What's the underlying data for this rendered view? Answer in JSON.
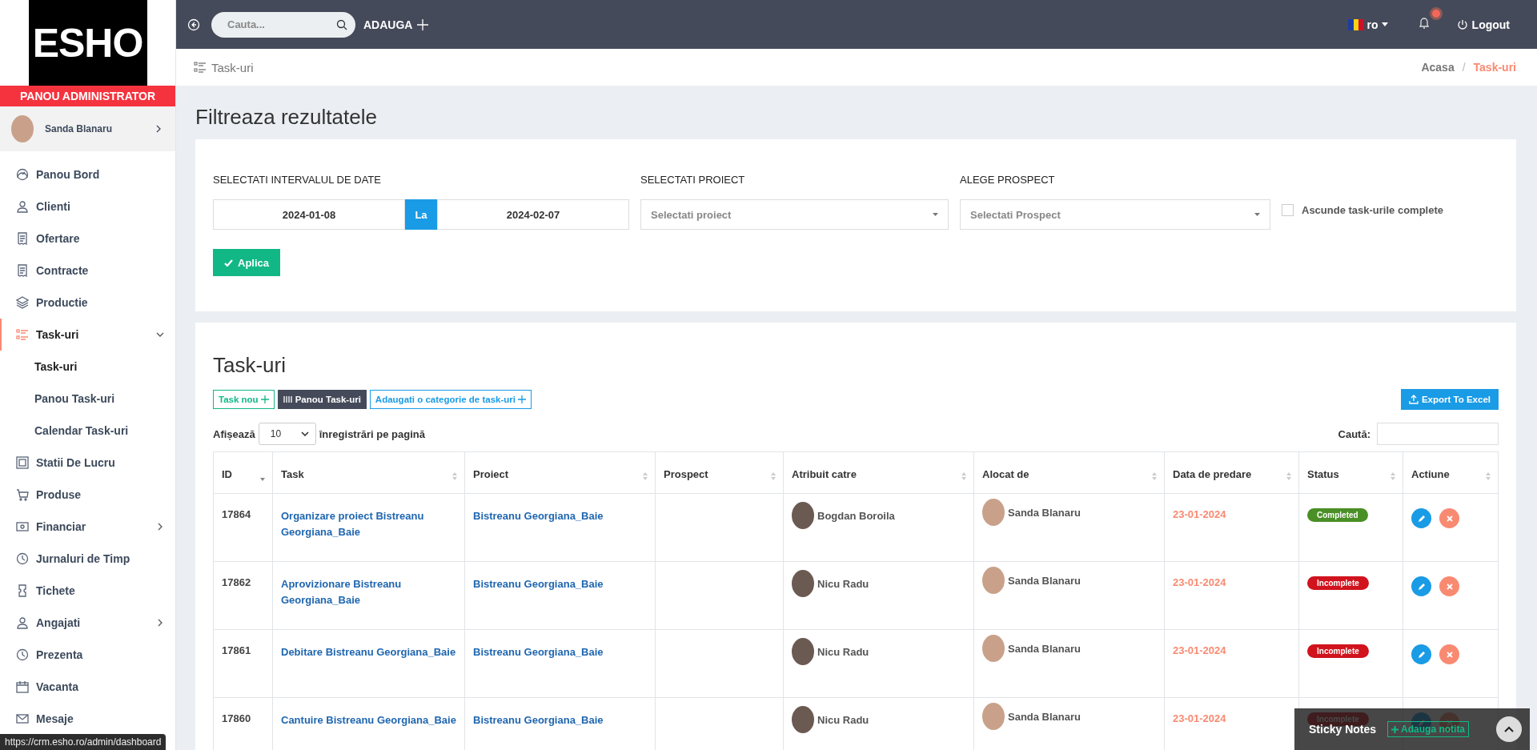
{
  "sidebar": {
    "brand": "ESHO",
    "role": "PANOU ADMINISTRATOR",
    "user": {
      "name": "Sanda Blanaru"
    },
    "items": [
      {
        "label": "Panou Bord",
        "kind": "link",
        "selected": false
      },
      {
        "label": "Clienti",
        "kind": "link",
        "selected": false
      },
      {
        "label": "Ofertare",
        "kind": "link",
        "selected": false
      },
      {
        "label": "Contracte",
        "kind": "link",
        "selected": false
      },
      {
        "label": "Productie",
        "kind": "link",
        "selected": false
      },
      {
        "label": "Task-uri",
        "kind": "group",
        "selected": true,
        "expanded": true,
        "children": [
          {
            "label": "Task-uri",
            "selected": true
          },
          {
            "label": "Panou Task-uri",
            "selected": false
          },
          {
            "label": "Calendar Task-uri",
            "selected": false
          }
        ]
      },
      {
        "label": "Statii De Lucru",
        "kind": "link",
        "selected": false
      },
      {
        "label": "Produse",
        "kind": "link",
        "selected": false
      },
      {
        "label": "Financiar",
        "kind": "group",
        "selected": false,
        "expanded": false
      },
      {
        "label": "Jurnaluri de Timp",
        "kind": "link",
        "selected": false
      },
      {
        "label": "Tichete",
        "kind": "link",
        "selected": false
      },
      {
        "label": "Angajati",
        "kind": "group",
        "selected": false,
        "expanded": false
      },
      {
        "label": "Prezenta",
        "kind": "link",
        "selected": false
      },
      {
        "label": "Vacanta",
        "kind": "link",
        "selected": false
      },
      {
        "label": "Mesaje",
        "kind": "link",
        "selected": false
      }
    ]
  },
  "topbar": {
    "search": {
      "placeholder": "Cauta..."
    },
    "add_label": "ADAUGA",
    "language": "ro",
    "notifications": true,
    "logout": "Logout"
  },
  "page_header": {
    "title": "Task-uri",
    "breadcrumb_separator": "/",
    "breadcrumb": [
      {
        "label": "Acasa",
        "selected": false
      },
      {
        "label": "Task-uri",
        "selected": true
      }
    ]
  },
  "filter": {
    "title": "Filtreaza rezultatele",
    "date_label": "SELECTATI INTERVALUL DE DATE",
    "date_from": "2024-01-08",
    "date_sep": "La",
    "date_to": "2024-02-07",
    "project_label": "SELECTATI PROIECT",
    "project_placeholder": "Selectati proiect",
    "prospect_label": "ALEGE PROSPECT",
    "prospect_placeholder": "Selectati Prospect",
    "hide_completed": {
      "label": "Ascunde task-urile complete",
      "checked": false
    },
    "apply": "Aplica"
  },
  "tasks": {
    "title": "Task-uri",
    "buttons": [
      {
        "label": "Task nou",
        "kind": "add"
      },
      {
        "label": "Panou Task-uri",
        "kind": "board"
      },
      {
        "label": "Adaugati o categorie de task-uri",
        "kind": "category"
      }
    ],
    "export": "Export To Excel",
    "length": {
      "before": "Afișează",
      "value": "10",
      "after": "înregistrări pe pagină"
    },
    "search_label": "Caută:",
    "columns": [
      {
        "label": "ID",
        "sorted": true
      },
      {
        "label": "Task",
        "sorted": false
      },
      {
        "label": "Proiect",
        "sorted": false
      },
      {
        "label": "Prospect",
        "sorted": false
      },
      {
        "label": "Atribuit catre",
        "sorted": false
      },
      {
        "label": "Alocat de",
        "sorted": false
      },
      {
        "label": "Data de predare",
        "sorted": false
      },
      {
        "label": "Status",
        "sorted": false
      },
      {
        "label": "Actiune",
        "sorted": false
      }
    ],
    "rows": [
      {
        "id": "17864",
        "task": "Organizare proiect Bistreanu Georgiana_Baie",
        "project": "Bistreanu Georgiana_Baie",
        "assignee": "Bogdan Boroila",
        "allocated_by": "Sanda Blanaru",
        "due": "23-01-2024",
        "status": {
          "label": "Completed",
          "kind": "completed"
        }
      },
      {
        "id": "17862",
        "task": "Aprovizionare Bistreanu Georgiana_Baie",
        "project": "Bistreanu Georgiana_Baie",
        "assignee": "Nicu Radu",
        "allocated_by": "Sanda Blanaru",
        "due": "23-01-2024",
        "status": {
          "label": "Incomplete",
          "kind": "incomplete"
        }
      },
      {
        "id": "17861",
        "task": "Debitare Bistreanu Georgiana_Baie",
        "project": "Bistreanu Georgiana_Baie",
        "assignee": "Nicu Radu",
        "allocated_by": "Sanda Blanaru",
        "due": "23-01-2024",
        "status": {
          "label": "Incomplete",
          "kind": "incomplete"
        }
      },
      {
        "id": "17860",
        "task": "Cantuire Bistreanu Georgiana_Baie",
        "project": "Bistreanu Georgiana_Baie",
        "assignee": "Nicu Radu",
        "allocated_by": "Sanda Blanaru",
        "due": "23-01-2024",
        "status": {
          "label": "Incomplete",
          "kind": "incomplete"
        }
      }
    ]
  },
  "sticky_notes": {
    "title": "Sticky Notes",
    "add": "Adauga notita"
  },
  "status_url": "https://crm.esho.ro/admin/dashboard"
}
